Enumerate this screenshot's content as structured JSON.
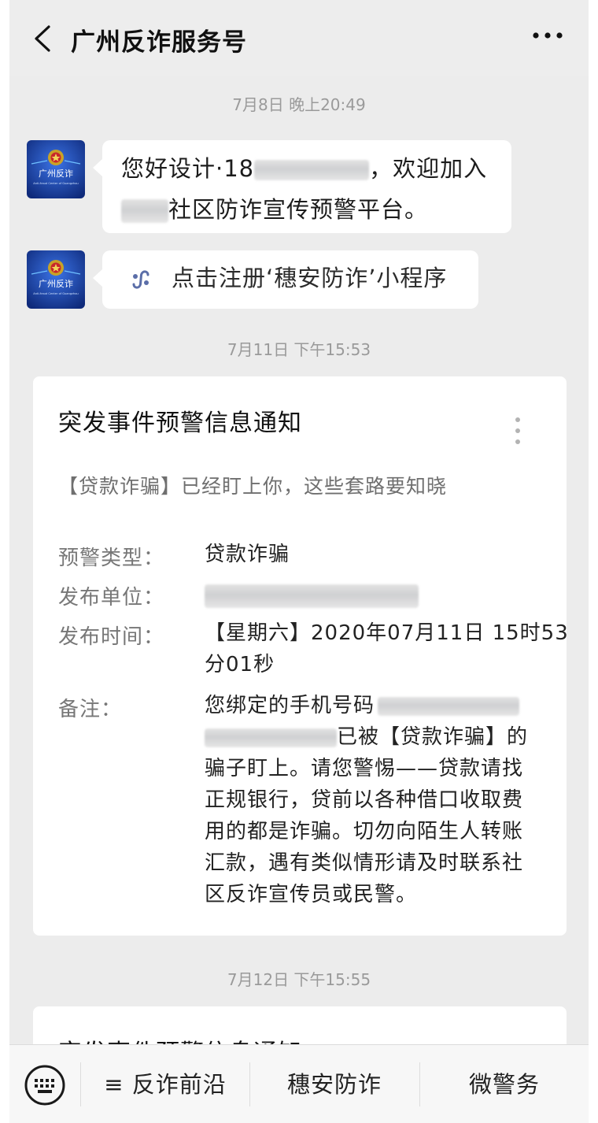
{
  "header": {
    "title": "广州反诈服务号",
    "back_icon": "chevron-left-icon",
    "more_icon": "ellipsis-icon"
  },
  "timestamps": [
    "7月8日 晚上20:49",
    "7月11日 下午15:53",
    "7月12日 下午15:55"
  ],
  "avatar": {
    "label_cn": "广州反诈",
    "label_en": "Anti-fraud Center of Guangzhou",
    "colors": {
      "bg": "#1c3fa8",
      "accent": "#4aa3ff"
    }
  },
  "messages": [
    {
      "line1_prefix": "您好设计·18",
      "line1_suffix": "，欢迎加入",
      "line2_suffix": "社区防诈宣传预警平台。"
    },
    {
      "icon": "mini-program-link-icon",
      "text": "点击注册‘穗安防诈’小程序"
    }
  ],
  "card": {
    "title": "突发事件预警信息通知",
    "subtitle": "【贷款诈骗】已经盯上你，这些套路要知晓",
    "fields": {
      "type_label": "预警类型：",
      "type_value": "贷款诈骗",
      "unit_label": "发布单位：",
      "time_label": "发布时间：",
      "time_value_1": "【星期六】2020年07月11日 15时53",
      "time_value_2": "分01秒",
      "remark_label": "备注：",
      "remark_1": "您绑定的手机号码",
      "remark_2": "已被【贷款诈骗】的",
      "remark_3": "骗子盯上。请您警惕——贷款请找",
      "remark_4": "正规银行，贷前以各种借口收取费",
      "remark_5": "用的都是诈骗。切勿向陌生人转账",
      "remark_6": "汇款，遇有类似情形请及时联系社",
      "remark_7": "区反诈宣传员或民警。"
    }
  },
  "card2": {
    "title": "突发事件预警信息通知"
  },
  "bottom_bar": {
    "keyboard_icon": "keyboard-icon",
    "items": [
      "≡ 反诈前沿",
      "穗安防诈",
      "微警务"
    ]
  },
  "colors": {
    "background": "#ececec",
    "bubble": "#ffffff",
    "timestamp": "#9a9a9a",
    "link_icon": "#5b6ea8"
  }
}
